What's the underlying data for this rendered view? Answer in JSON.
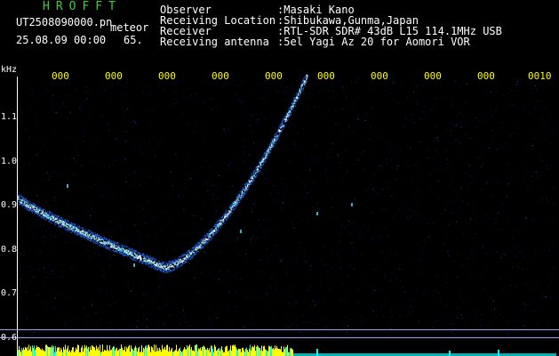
{
  "header": {
    "logo": "HROFFT",
    "filename": "UT2508090000.pn",
    "meteor_label": "meteor",
    "datetime": "25.08.09 00:00",
    "count": "65.",
    "rows": [
      {
        "label": "Observer",
        "value": ":Masaki Kano"
      },
      {
        "label": "Receiving Location",
        "value": ":Shibukawa,Gunma,Japan"
      },
      {
        "label": "Receiver",
        "value": ":RTL-SDR SDR# 43dB L15 114.1MHz USB"
      },
      {
        "label": "Receiving antenna",
        "value": ":5el Yagi Az 20 for Aomori VOR"
      }
    ]
  },
  "axis": {
    "y_unit": "kHz",
    "y_ticks": [
      "1.1",
      "1.0",
      "0.9",
      "0.8",
      "0.7",
      "0.6"
    ],
    "x_ticks": [
      "000",
      "000",
      "000",
      "000",
      "000",
      "000",
      "000",
      "000",
      "000",
      "0010"
    ]
  },
  "colors": {
    "logo": "#3ccc3c",
    "tick_text": "#ffff00",
    "plot_border": "#ffff00",
    "signal_core": "#4fd2ff",
    "signal_mid": "#2a6cff",
    "noise_floor": "#1a2a9a",
    "bottom_bar": "#ffff00",
    "bottom_cyan": "#00ffff"
  }
}
